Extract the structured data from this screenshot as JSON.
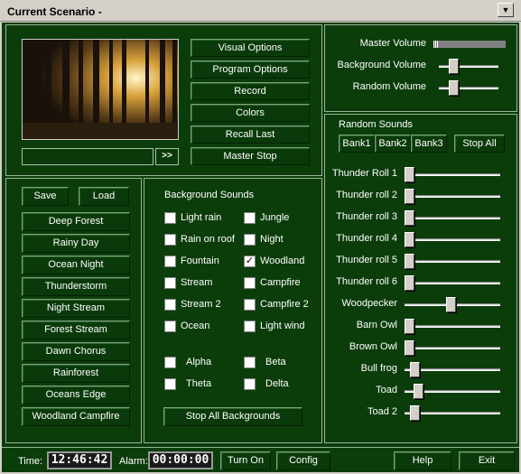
{
  "window": {
    "title": "Current Scenario -"
  },
  "program_buttons": [
    "Visual Options",
    "Program Options",
    "Record",
    "Colors",
    "Recall Last",
    "Master Stop"
  ],
  "preview": {
    "next_label": ">>"
  },
  "scenarios": {
    "save_label": "Save",
    "load_label": "Load",
    "items": [
      "Deep Forest",
      "Rainy Day",
      "Ocean Night",
      "Thunderstorm",
      "Night Stream",
      "Forest Stream",
      "Dawn Chorus",
      "Rainforest",
      "Oceans Edge",
      "Woodland Campfire"
    ]
  },
  "background": {
    "heading": "Background Sounds",
    "left": [
      {
        "label": "Light rain",
        "checked": false
      },
      {
        "label": "Rain on roof",
        "checked": false
      },
      {
        "label": "Fountain",
        "checked": false
      },
      {
        "label": "Stream",
        "checked": false
      },
      {
        "label": "Stream 2",
        "checked": false
      },
      {
        "label": "Ocean",
        "checked": false
      }
    ],
    "right": [
      {
        "label": "Jungle",
        "checked": false
      },
      {
        "label": "Night",
        "checked": false
      },
      {
        "label": "Woodland",
        "checked": true
      },
      {
        "label": "Campfire",
        "checked": false
      },
      {
        "label": "Campfire 2",
        "checked": false
      },
      {
        "label": "Light wind",
        "checked": false
      }
    ],
    "waves": [
      {
        "label": "Alpha",
        "checked": false
      },
      {
        "label": "Beta",
        "checked": false
      },
      {
        "label": "Theta",
        "checked": false
      },
      {
        "label": "Delta",
        "checked": false
      }
    ],
    "stop_label": "Stop All Backgrounds"
  },
  "volumes": [
    {
      "label": "Master Volume",
      "value": 0.0
    },
    {
      "label": "Background Volume",
      "value": 0.2
    },
    {
      "label": "Random Volume",
      "value": 0.2
    }
  ],
  "random": {
    "heading": "Random Sounds",
    "banks": [
      "Bank1",
      "Bank2",
      "Bank3"
    ],
    "stop_label": "Stop All",
    "sliders": [
      {
        "label": "Thunder Roll 1",
        "value": 0.0
      },
      {
        "label": "Thunder roll 2",
        "value": 0.0
      },
      {
        "label": "Thunder roll 3",
        "value": 0.0
      },
      {
        "label": "Thunder roll 4",
        "value": 0.0
      },
      {
        "label": "Thunder roll 5",
        "value": 0.0
      },
      {
        "label": "Thunder roll 6",
        "value": 0.0
      },
      {
        "label": "Woodpecker",
        "value": 0.48
      },
      {
        "label": "Barn Owl",
        "value": 0.0
      },
      {
        "label": "Brown Owl",
        "value": 0.0
      },
      {
        "label": "Bull frog",
        "value": 0.06
      },
      {
        "label": "Toad",
        "value": 0.1
      },
      {
        "label": "Toad 2",
        "value": 0.06
      }
    ]
  },
  "status": {
    "time_label": "Time:",
    "time_value": "12:46:42",
    "alarm_label": "Alarm:",
    "alarm_value": "00:00:00",
    "turn_on_label": "Turn On",
    "config_label": "Config",
    "help_label": "Help",
    "exit_label": "Exit"
  }
}
